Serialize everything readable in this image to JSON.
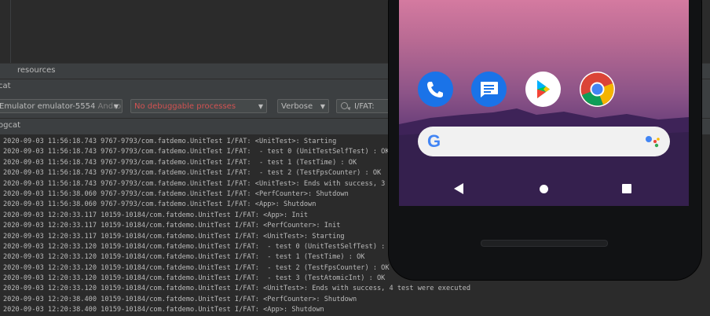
{
  "panel": {
    "resources_label": "resources",
    "tool_window_title": "cat",
    "logcat_title": "ogcat"
  },
  "toolbar": {
    "device_combo": {
      "value": "Emulator emulator-5554",
      "suffix": "Androi"
    },
    "process_combo": {
      "value": "No debuggable processes"
    },
    "level_combo": {
      "value": "Verbose"
    },
    "search": {
      "value": "I/FAT:"
    }
  },
  "log_lines": [
    "2020-09-03 11:56:18.743 9767-9793/com.fatdemo.UnitTest I/FAT: <UnitTest>: Starting",
    "2020-09-03 11:56:18.743 9767-9793/com.fatdemo.UnitTest I/FAT:  - test 0 (UnitTestSelfTest) : OK",
    "2020-09-03 11:56:18.743 9767-9793/com.fatdemo.UnitTest I/FAT:  - test 1 (TestTime) : OK",
    "2020-09-03 11:56:18.743 9767-9793/com.fatdemo.UnitTest I/FAT:  - test 2 (TestFpsCounter) : OK",
    "2020-09-03 11:56:18.743 9767-9793/com.fatdemo.UnitTest I/FAT: <UnitTest>: Ends with success, 3 tes",
    "2020-09-03 11:56:38.060 9767-9793/com.fatdemo.UnitTest I/FAT: <PerfCounter>: Shutdown",
    "2020-09-03 11:56:38.060 9767-9793/com.fatdemo.UnitTest I/FAT: <App>: Shutdown",
    "2020-09-03 12:20:33.117 10159-10184/com.fatdemo.UnitTest I/FAT: <App>: Init",
    "2020-09-03 12:20:33.117 10159-10184/com.fatdemo.UnitTest I/FAT: <PerfCounter>: Init",
    "2020-09-03 12:20:33.117 10159-10184/com.fatdemo.UnitTest I/FAT: <UnitTest>: Starting",
    "2020-09-03 12:20:33.120 10159-10184/com.fatdemo.UnitTest I/FAT:  - test 0 (UnitTestSelfTest) : OK",
    "2020-09-03 12:20:33.120 10159-10184/com.fatdemo.UnitTest I/FAT:  - test 1 (TestTime) : OK",
    "2020-09-03 12:20:33.120 10159-10184/com.fatdemo.UnitTest I/FAT:  - test 2 (TestFpsCounter) : OK",
    "2020-09-03 12:20:33.120 10159-10184/com.fatdemo.UnitTest I/FAT:  - test 3 (TestAtomicInt) : OK",
    "2020-09-03 12:20:33.120 10159-10184/com.fatdemo.UnitTest I/FAT: <UnitTest>: Ends with success, 4 test were executed",
    "2020-09-03 12:20:38.400 10159-10184/com.fatdemo.UnitTest I/FAT: <PerfCounter>: Shutdown",
    "2020-09-03 12:20:38.400 10159-10184/com.fatdemo.UnitTest I/FAT: <App>: Shutdown"
  ],
  "emulator": {
    "dock_apps": [
      "phone-icon",
      "messages-icon",
      "play-store-icon",
      "chrome-icon"
    ],
    "search_logo": "G",
    "nav_icons": [
      "back-icon",
      "home-icon",
      "recents-icon"
    ]
  },
  "colors": {
    "ide_background": "#2b2b2b",
    "panel_background": "#3c3f41",
    "error_text": "#d25252",
    "wallpaper_top": "#d47aa0",
    "wallpaper_bottom": "#4c2c66"
  }
}
